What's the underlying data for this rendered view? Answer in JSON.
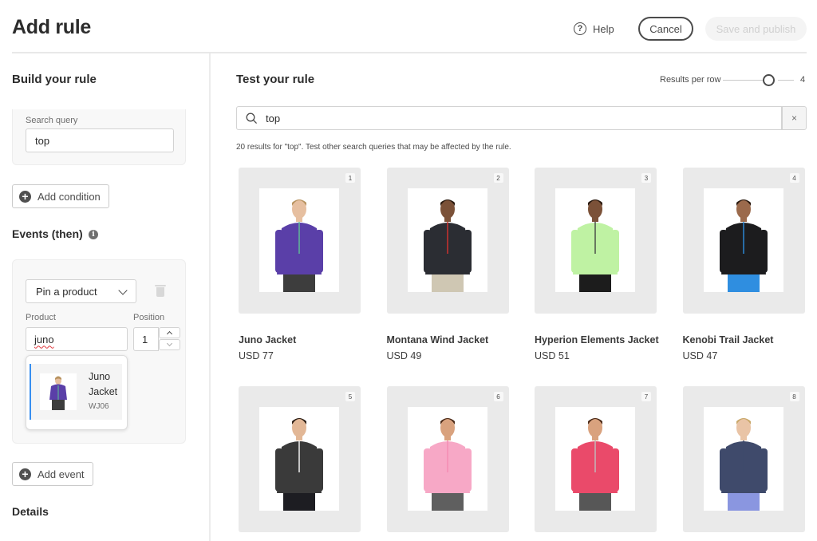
{
  "header": {
    "title": "Add rule",
    "help_label": "Help",
    "cancel_label": "Cancel",
    "save_label": "Save and publish"
  },
  "build": {
    "title": "Build your rule",
    "search_query_label": "Search query",
    "search_query_value": "top",
    "add_condition_label": "Add condition",
    "events_title": "Events (then)",
    "event": {
      "action_selected": "Pin a product",
      "product_label": "Product",
      "product_value": "juno",
      "position_label": "Position",
      "position_value": "1",
      "suggestion": {
        "name": "Juno Jacket",
        "sku": "WJ06"
      }
    },
    "add_event_label": "Add event",
    "details_title": "Details"
  },
  "test": {
    "title": "Test your rule",
    "results_per_row_label": "Results per row",
    "results_per_row_value": "4",
    "search_value": "top",
    "clear_label": "×",
    "results_info": "20 results for \"top\". Test other search queries that may be affected by the rule.",
    "products": [
      {
        "position": "1",
        "name": "Juno Jacket",
        "price": "USD 77",
        "colors": {
          "top": "#5a3fa8",
          "bottom": "#3d3d3d",
          "skin": "#e6bfa0",
          "hair": "#b89360",
          "accent": "#5fc495"
        }
      },
      {
        "position": "2",
        "name": "Montana Wind Jacket",
        "price": "USD 49",
        "colors": {
          "top": "#2b2d33",
          "bottom": "#cfc7b3",
          "skin": "#7b5138",
          "hair": "#2a1a10",
          "accent": "#d8322e"
        }
      },
      {
        "position": "3",
        "name": "Hyperion Elements Jacket",
        "price": "USD 51",
        "colors": {
          "top": "#bff2a3",
          "bottom": "#1c1c1c",
          "skin": "#7b5138",
          "hair": "#2a1a10",
          "accent": "#444444"
        }
      },
      {
        "position": "4",
        "name": "Kenobi Trail Jacket",
        "price": "USD 47",
        "colors": {
          "top": "#1c1c1e",
          "bottom": "#2f8ee0",
          "skin": "#9b6a4c",
          "hair": "#2a1a10",
          "accent": "#2f8ee0"
        }
      },
      {
        "position": "5",
        "name": "",
        "price": "",
        "colors": {
          "top": "#3a3a3a",
          "bottom": "#1d1d22",
          "skin": "#e2b796",
          "hair": "#2b1d14",
          "accent": "#ffffff"
        }
      },
      {
        "position": "6",
        "name": "",
        "price": "",
        "colors": {
          "top": "#f7a8c6",
          "bottom": "#5f5f5f",
          "skin": "#d9a27e",
          "hair": "#4a2a18",
          "accent": "#f48ab2"
        }
      },
      {
        "position": "7",
        "name": "",
        "price": "",
        "colors": {
          "top": "#ea4a6a",
          "bottom": "#575757",
          "skin": "#d9a27e",
          "hair": "#4a2a18",
          "accent": "#c0c0c0"
        }
      },
      {
        "position": "8",
        "name": "",
        "price": "",
        "colors": {
          "top": "#3f4a6b",
          "bottom": "#8a96e0",
          "skin": "#e9c4a6",
          "hair": "#c9a86a",
          "accent": "#3f4a6b"
        }
      }
    ]
  },
  "colors": {
    "accent_blue": "#378ef0",
    "text_primary": "#2c2c2c",
    "card_bg": "#eaeaea"
  }
}
